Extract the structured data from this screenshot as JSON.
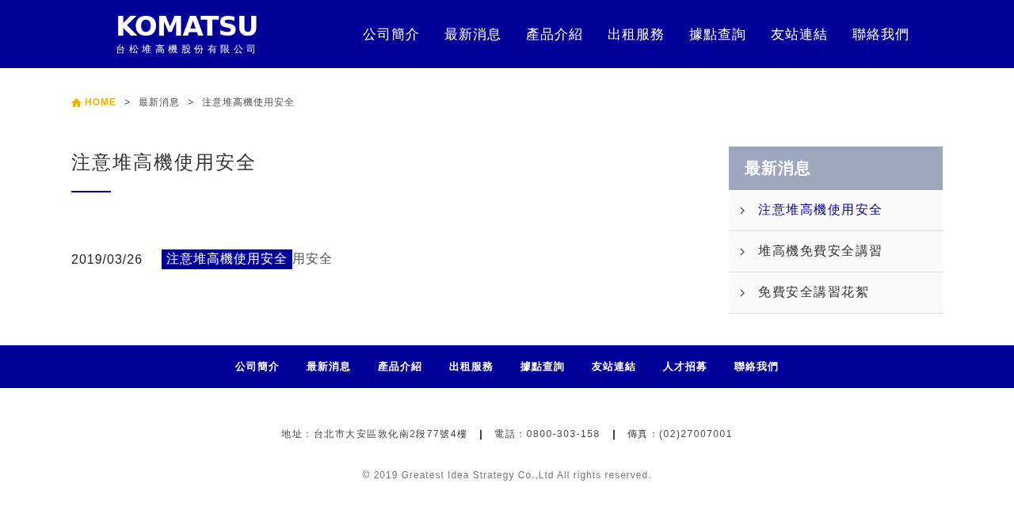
{
  "header": {
    "logo": {
      "brand": "KOMATSU",
      "subtitle": "台松堆高機股份有限公司"
    },
    "nav": [
      "公司簡介",
      "最新消息",
      "產品介紹",
      "出租服務",
      "據點查詢",
      "友站連結",
      "聯絡我們"
    ]
  },
  "breadcrumb": [
    {
      "label": "HOME",
      "kind": "home"
    },
    {
      "label": ">",
      "kind": "sep"
    },
    {
      "label": "最新消息",
      "kind": "link"
    },
    {
      "label": ">",
      "kind": "sep"
    },
    {
      "label": "注意堆高機使用安全",
      "kind": "current"
    }
  ],
  "article": {
    "title": "注意堆高機使用安全",
    "posts": [
      {
        "date": "2019/03/26",
        "tag": "注意堆高機使用安全",
        "title_visible": "用安全"
      }
    ]
  },
  "sidebar": {
    "title": "最新消息",
    "items": [
      {
        "label": "注意堆高機使用安全",
        "selected": true
      },
      {
        "label": "堆高機免費安全講習",
        "selected": false
      },
      {
        "label": "免費安全講習花絮",
        "selected": false
      }
    ]
  },
  "footer": {
    "nav": [
      "公司簡介",
      "最新消息",
      "產品介紹",
      "出租服務",
      "據點查詢",
      "友站連結",
      "人才招募",
      "聯絡我們"
    ],
    "contact": [
      "地址：台北市大安區敦化南2段77號4樓",
      "電話：0800-303-158",
      "傳真：(02)27007001"
    ],
    "copyright": "© 2019 Greatest Idea Strategy Co.,Ltd All rights reserved."
  }
}
